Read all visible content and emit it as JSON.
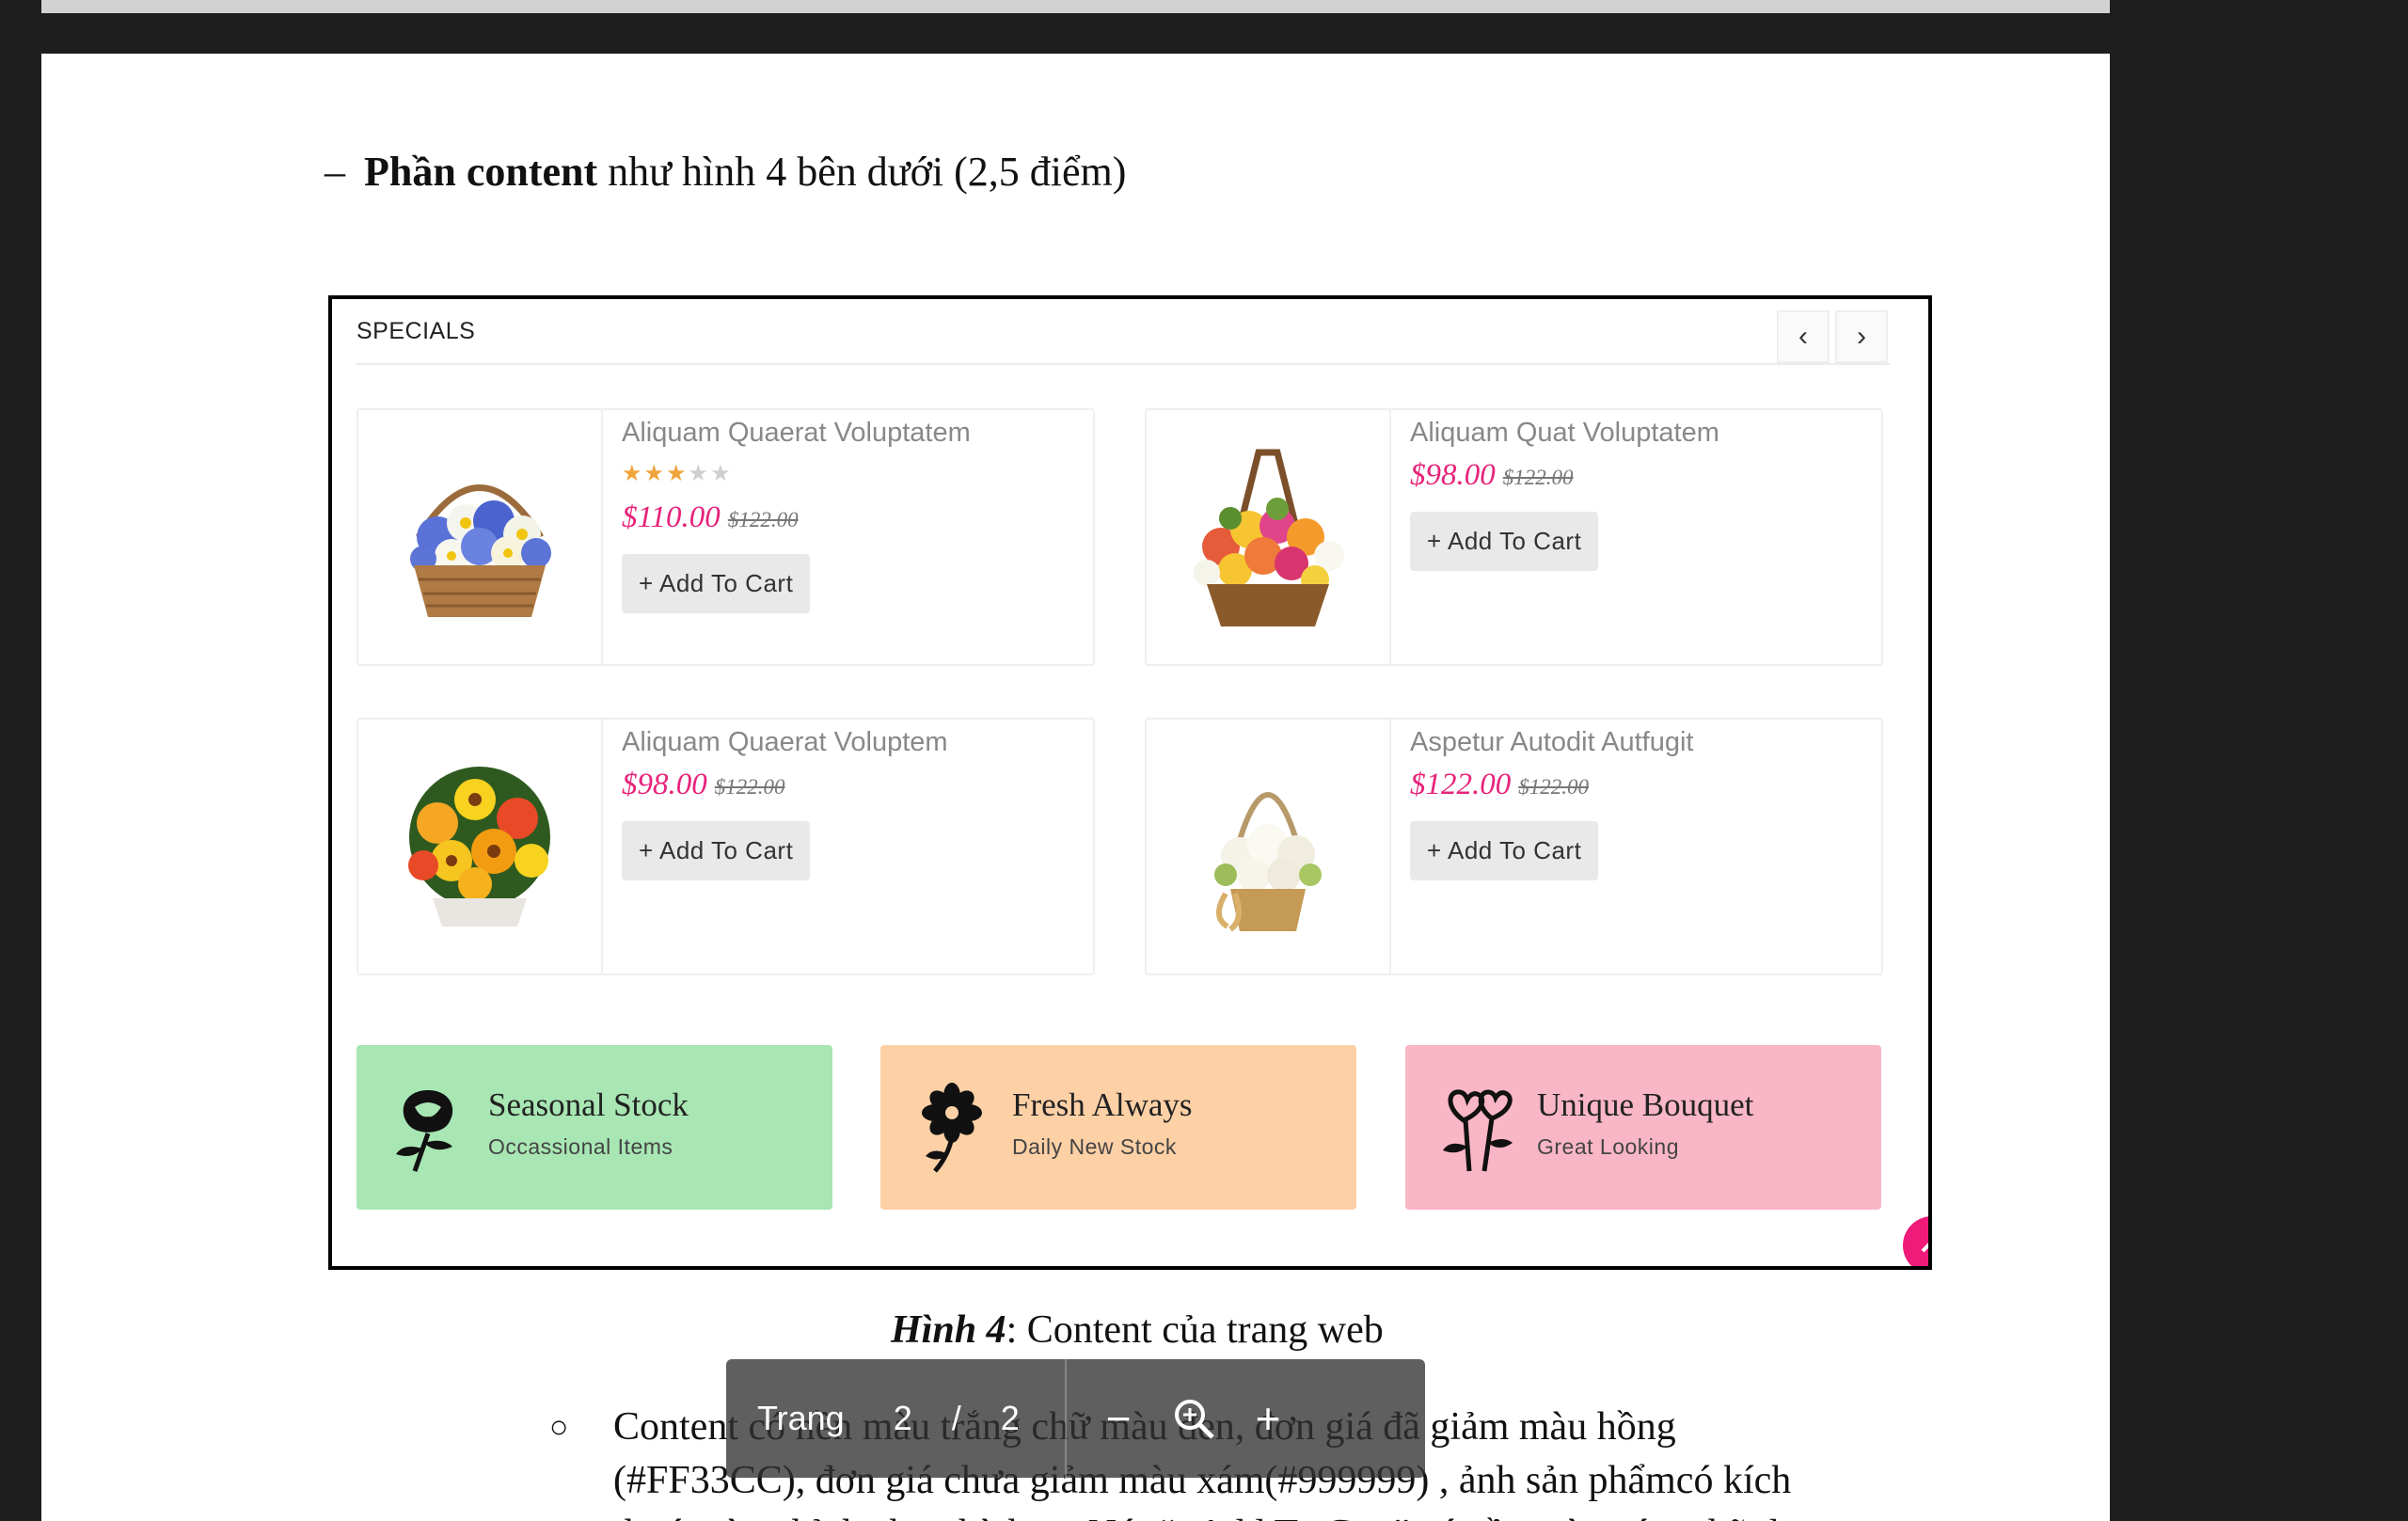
{
  "document": {
    "heading": {
      "dash": "–",
      "bold": "Phần content",
      "rest": " như hình 4 bên dưới (2,5 điểm)"
    },
    "figure": {
      "section_title": "SPECIALS",
      "prev_icon": "‹",
      "next_icon": "›",
      "products": [
        {
          "name": "Aliquam Quaerat Voluptatem",
          "rating": 3,
          "rating_max": 5,
          "price": "$110.00",
          "old_price": "$122.00",
          "button": "+ Add To Cart",
          "image": "blue-flower-basket"
        },
        {
          "name": "Aliquam Quat Voluptatem",
          "price": "$98.00",
          "old_price": "$122.00",
          "button": "+ Add To Cart",
          "image": "mixed-flower-basket"
        },
        {
          "name": "Aliquam Quaerat Voluptem",
          "price": "$98.00",
          "old_price": "$122.00",
          "button": "+ Add To Cart",
          "image": "yellow-flower-basket"
        },
        {
          "name": "Aspetur Autodit Autfugit",
          "price": "$122.00",
          "old_price": "$122.00",
          "button": "+ Add To Cart",
          "image": "white-flower-basket"
        }
      ],
      "banners": [
        {
          "title": "Seasonal Stock",
          "subtitle": "Occassional Items",
          "icon": "rose-icon",
          "color": "#a8e6b3"
        },
        {
          "title": "Fresh Always",
          "subtitle": "Daily New Stock",
          "icon": "flower-icon",
          "color": "#fdd0a6"
        },
        {
          "title": "Unique Bouquet",
          "subtitle": "Great Looking",
          "icon": "hearts-icon",
          "color": "#f9b6c6"
        }
      ],
      "scroll_top_icon": "^"
    },
    "caption": {
      "label": "Hình 4",
      "rest": ": Content của trang web"
    },
    "paragraph": {
      "bullet": "○",
      "lines": [
        "Content có nền màu trắng chữ màu đen, đơn giá đã giảm màu hồng",
        "(#FF33CC), đơn giá chưa giảm màu xám(#999999) , ảnh sản phẩmcó kích",
        "thước tùy chỉnh cho phù hợp. Nút “+Add To Cart” có nền màu xám chữ đen"
      ]
    }
  },
  "pdf_toolbar": {
    "page_label": "Trang",
    "current_page": "2",
    "separator": "/",
    "total_pages": "2",
    "zoom_out": "−",
    "zoom_in": "+"
  },
  "colors": {
    "price_pink": "#e8237a",
    "old_price_gray": "#777777",
    "button_gray": "#e9e9e9",
    "scroll_top_pink": "#f01a7a"
  }
}
